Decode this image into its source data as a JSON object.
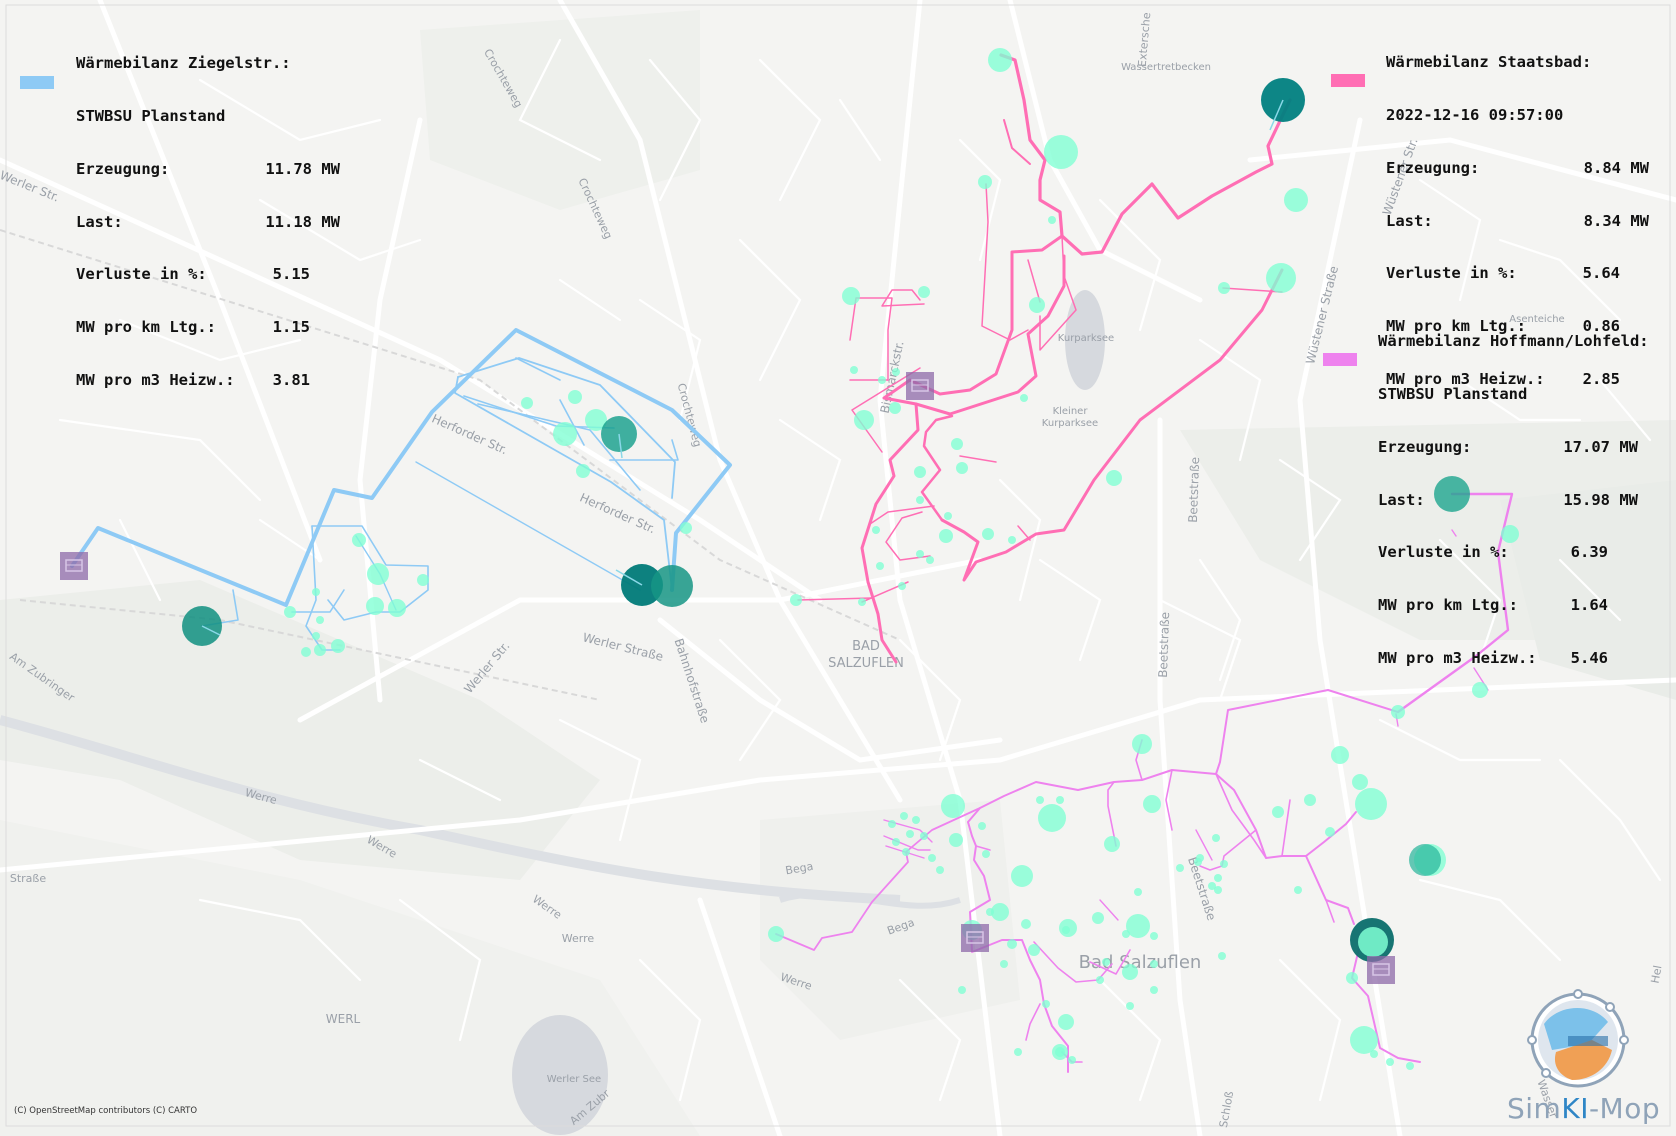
{
  "panels": {
    "ziegelstr": {
      "title": "Wärmebilanz Ziegelstr.:",
      "subtitle": "STWBSU Planstand",
      "rows": [
        {
          "label": "Erzeugung:",
          "value": "11.78 MW"
        },
        {
          "label": "Last:",
          "value": "11.18 MW"
        },
        {
          "label": "Verluste in %:",
          "value": "5.15"
        },
        {
          "label": "MW pro km Ltg.:",
          "value": "1.15"
        },
        {
          "label": "MW pro m3 Heizw.:",
          "value": "3.81"
        }
      ],
      "color": "#8ecaf5"
    },
    "staatsbad": {
      "title": "Wärmebilanz Staatsbad:",
      "subtitle": "2022-12-16 09:57:00",
      "rows": [
        {
          "label": "Erzeugung:",
          "value": "8.84 MW"
        },
        {
          "label": "Last:",
          "value": "8.34 MW"
        },
        {
          "label": "Verluste in %:",
          "value": "5.64"
        },
        {
          "label": "MW pro km Ltg.:",
          "value": "0.86"
        },
        {
          "label": "MW pro m3 Heizw.:",
          "value": "2.85"
        }
      ],
      "color": "#ff6eb4"
    },
    "hoffmann": {
      "title": "Wärmebilanz Hoffmann/Lohfeld:",
      "subtitle": "STWBSU Planstand",
      "rows": [
        {
          "label": "Erzeugung:",
          "value": "17.07 MW"
        },
        {
          "label": "Last:",
          "value": "15.98 MW"
        },
        {
          "label": "Verluste in %:",
          "value": "6.39"
        },
        {
          "label": "MW pro km Ltg.:",
          "value": "1.64"
        },
        {
          "label": "MW pro m3 Heizw.:",
          "value": "5.46"
        }
      ],
      "color": "#ee82ee"
    }
  },
  "map_labels": {
    "bad_salzuflen_center_1": "BAD",
    "bad_salzuflen_center_2": "SALZUFLEN",
    "bad_salzuflen": "Bad Salzuflen",
    "werl": "WERL",
    "werler_see": "Werler See",
    "kurparksee": "Kurparksee",
    "kleiner_1": "Kleiner",
    "kleiner_2": "Kurparksee",
    "wassertretbecken": "Wassertretbecken",
    "asenteiche": "Asenteiche",
    "herforder_str_1": "Herforder Str.",
    "herforder_str_2": "Herforder Str.",
    "werler_strasse": "Werler Straße",
    "werler_str": "Werler Str.",
    "werler_str_top": "Werler Str.",
    "bahnhofstrasse": "Bahnhofstraße",
    "bismarckstr": "Bismarckstr.",
    "beetstrasse_1": "Beetstraße",
    "beetstrasse_2": "Beetstraße",
    "beetstrasse_3": "Beetstraße",
    "wuestener_strasse": "Wüstener Straße",
    "wuestener_str": "Wüstener Str.",
    "crochteweg_1": "Crochteweg",
    "crochteweg_2": "Crochteweg",
    "crochteweg_3": "Crochteweg",
    "am_zubringer": "Am Zubringer",
    "am_zubr": "Am Zubr",
    "werre_1": "Werre",
    "werre_2": "Werre",
    "werre_3": "Werre",
    "werre_4": "Werre",
    "werre_5": "Werre",
    "bega_1": "Bega",
    "bega_2": "Bega",
    "strasse_left": "Straße",
    "schloss": "Schloß",
    "wasser": "Wasser",
    "extersche": "Extersche",
    "hel": "Hel"
  },
  "attribution": "(C) OpenStreetMap contributors (C) CARTO",
  "brand": {
    "part1": "Sim",
    "part2": "KI",
    "part3": "-Mop"
  },
  "colors": {
    "ziegelstr_network": "#8ecaf5",
    "staatsbad_network": "#ff6eb4",
    "hoffmann_network": "#ee82ee",
    "consumer": "#7fffd4",
    "producer": "#008080",
    "plant_icon": "#8e6aa8"
  }
}
